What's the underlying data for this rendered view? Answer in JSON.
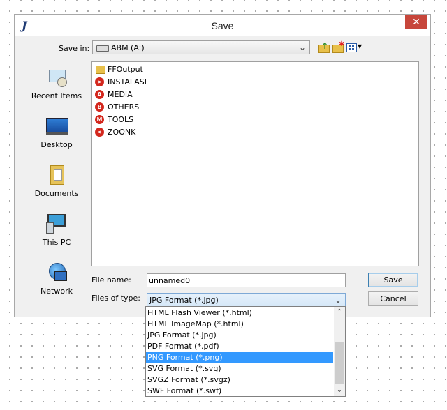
{
  "dialog": {
    "title": "Save",
    "close_glyph": "✕",
    "icons": {
      "app": "app-logo-icon",
      "close": "close-icon"
    }
  },
  "save_in": {
    "label": "Save in:",
    "value": "ABM (A:)",
    "toolbar_icons": [
      "up-one-level-icon",
      "new-folder-icon",
      "view-menu-icon"
    ]
  },
  "places": [
    {
      "label": "Recent Items",
      "icon": "recent-items-icon"
    },
    {
      "label": "Desktop",
      "icon": "desktop-icon"
    },
    {
      "label": "Documents",
      "icon": "documents-icon"
    },
    {
      "label": "This PC",
      "icon": "this-pc-icon"
    },
    {
      "label": "Network",
      "icon": "network-icon"
    }
  ],
  "files": [
    {
      "name": "FFOutput",
      "icon": "folder-icon"
    },
    {
      "name": "INSTALASI",
      "badge": ">",
      "icon": "red-circle-icon"
    },
    {
      "name": "MEDIA",
      "badge": "A",
      "icon": "red-circle-icon"
    },
    {
      "name": "OTHERS",
      "badge": "B",
      "icon": "red-circle-icon"
    },
    {
      "name": "TOOLS",
      "badge": "M",
      "icon": "red-circle-icon"
    },
    {
      "name": "ZOONK",
      "badge": "<",
      "icon": "red-circle-icon"
    }
  ],
  "file_name": {
    "label": "File name:",
    "value": "unnamed0"
  },
  "file_type": {
    "label": "Files of type:",
    "value": "JPG Format (*.jpg)",
    "options": [
      "HTML Flash Viewer (*.html)",
      "HTML ImageMap (*.html)",
      "JPG Format (*.jpg)",
      "PDF Format (*.pdf)",
      "PNG Format (*.png)",
      "SVG Format (*.svg)",
      "SVGZ Format (*.svgz)",
      "SWF Format (*.swf)"
    ],
    "highlighted_option": "PNG Format (*.png)"
  },
  "buttons": {
    "save": "Save",
    "cancel": "Cancel"
  },
  "colors": {
    "close": "#c7463b",
    "selection": "#3399ff",
    "folder": "#e8c04a",
    "drive_badge": "#d3271d"
  }
}
